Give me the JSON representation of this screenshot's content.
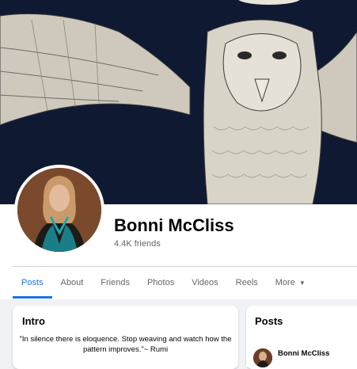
{
  "profile": {
    "name": "Bonni McCliss",
    "friends": "4.4K friends"
  },
  "tabs": [
    {
      "label": "Posts",
      "active": true
    },
    {
      "label": "About",
      "active": false
    },
    {
      "label": "Friends",
      "active": false
    },
    {
      "label": "Photos",
      "active": false
    },
    {
      "label": "Videos",
      "active": false
    },
    {
      "label": "Reels",
      "active": false
    },
    {
      "label": "More",
      "active": false
    }
  ],
  "intro": {
    "title": "Intro",
    "quote": "\"In silence there is eloquence. Stop weaving and watch how the pattern improves.\"~ Rumi"
  },
  "posts": {
    "title": "Posts",
    "author": "Bonni McCliss"
  },
  "colors": {
    "accent": "#1b74e4",
    "background": "#f0f2f5",
    "cover_bg": "#111a33"
  }
}
